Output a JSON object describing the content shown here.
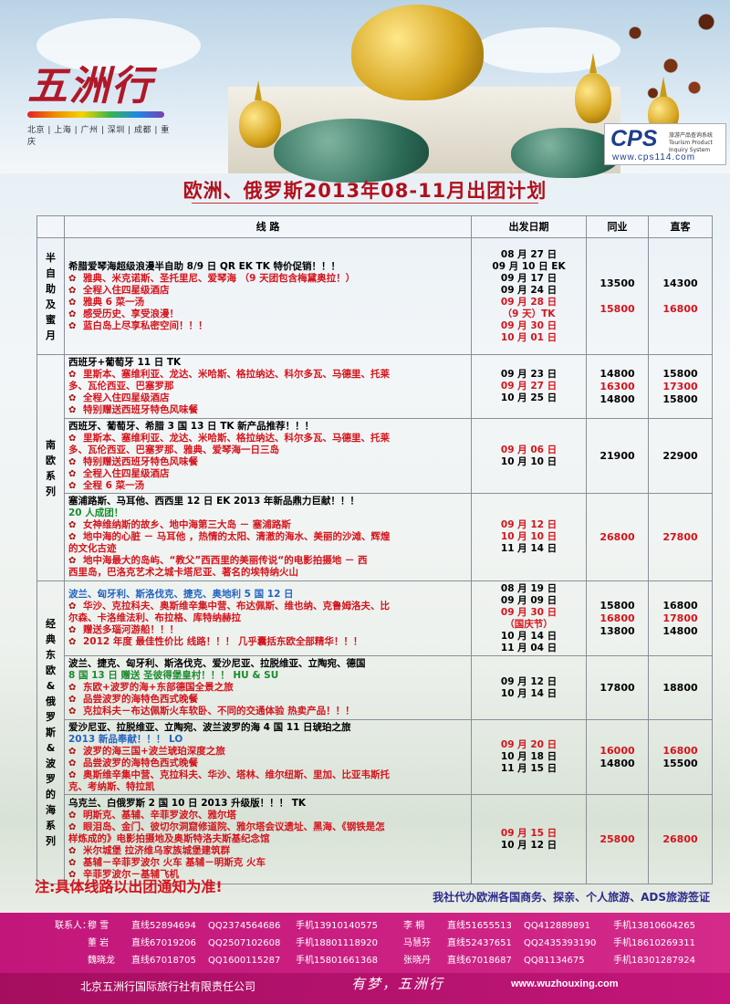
{
  "header": {
    "logo_text": "五洲行",
    "logo_cities": "北京 | 上海 | 广州 | 深圳 | 成都 | 重庆",
    "cps_brand": "CPS",
    "cps_subtitle": "旅游产品查询系统 Tourism Product Inquiry System",
    "cps_url": "www.cps114.com"
  },
  "title": "欧洲、俄罗斯2013年08-11月出团计划",
  "table": {
    "headers": {
      "route": "线 路",
      "dates": "出发日期",
      "peer": "同业",
      "direct": "直客"
    },
    "categories": {
      "c1": "半自助及蜜月",
      "c2": "南欧系列",
      "c3": "经典东欧&俄罗斯&波罗的海系列"
    },
    "rows": [
      {
        "lines": [
          "希腊爱琴海超级浪漫半自助 8/9 日 QR EK TK 特价促销！！！",
          "雅典、米克诺斯、圣托里尼、爱琴海 （9 天团包含梅黛奥拉！）",
          "全程入住四星级酒店",
          "雅典 6 菜一汤",
          "感受历史、享受浪漫！",
          "蓝白岛上尽享私密空间！！！"
        ],
        "dates": [
          "08 月 27 日",
          "09 月 10 日 EK",
          "09 月 17 日",
          "09 月 24 日",
          "09 月 28 日",
          "（9 天）TK",
          "09 月 30 日",
          "10 月 01 日"
        ],
        "peer": [
          "13500",
          "15800"
        ],
        "direct": [
          "14300",
          "16800"
        ]
      },
      {
        "lines": [
          "西班牙+葡萄牙 11 日 TK",
          "里斯本、塞维利亚、龙达、米哈斯、格拉纳达、科尔多瓦、马德里、托莱",
          "多、瓦伦西亚、巴塞罗那",
          "全程入住四星级酒店",
          "特别赠送西班牙特色风味餐"
        ],
        "dates": [
          "09 月 23 日",
          "09 月 27 日",
          "10 月 25 日"
        ],
        "peer": [
          "14800",
          "16300",
          "14800"
        ],
        "direct": [
          "15800",
          "17300",
          "15800"
        ]
      },
      {
        "lines": [
          "西班牙、葡萄牙、希腊 3 国 13 日 TK 新产品推荐！！！",
          "里斯本、塞维利亚、龙达、米哈斯、格拉纳达、科尔多瓦、马德里、托莱",
          "多、瓦伦西亚、巴塞罗那、雅典、爱琴海一日三岛",
          "特别赠送西班牙特色风味餐",
          "全程入住四星级酒店",
          "全程 6 菜一汤"
        ],
        "dates": [
          "09 月 06 日",
          "10 月 10 日"
        ],
        "peer": [
          "21900"
        ],
        "direct": [
          "22900"
        ]
      },
      {
        "lines": [
          "塞浦路斯、马耳他、西西里 12 日 EK 2013 年新品鼎力巨献！！！",
          "20 人成团！",
          "女神维纳斯的故乡、地中海第三大岛 － 塞浦路斯",
          "地中海的心脏 － 马耳他 ，热情的太阳、清澈的海水、美丽的沙滩、辉煌",
          "的文化古迹",
          "地中海最大的岛屿、“教父”西西里的美丽传说“的电影拍摄地 － 西",
          "西里岛，巴洛克艺术之城卡塔尼亚、著名的埃特纳火山"
        ],
        "dates": [
          "09 月 12 日",
          "10 月 10 日",
          "11 月 14 日"
        ],
        "peer": [
          "26800"
        ],
        "direct": [
          "27800"
        ]
      },
      {
        "lines": [
          "波兰、匈牙利、斯洛伐克、捷克、奥地利 5 国 12 日",
          "华沙、克拉科夫、奥斯维辛集中营、布达佩斯、维也纳、克鲁姆洛夫、比",
          "尔森、卡洛维法利、布拉格、库特纳赫拉",
          "赠送多瑙河游船！！！",
          "2012 年度 最佳性价比 线路！！！ 几乎囊括东欧全部精华！！！"
        ],
        "dates": [
          "08 月 19 日",
          "09 月 09 日",
          "09 月 30 日",
          "（国庆节）",
          "10 月 14 日",
          "11 月 04 日"
        ],
        "peer": [
          "15800",
          "16800",
          "13800"
        ],
        "direct": [
          "16800",
          "17800",
          "14800"
        ]
      },
      {
        "lines": [
          "波兰、捷克、匈牙利、斯洛伐克、爱沙尼亚、拉脱维亚、立陶宛、德国",
          "8 国 13 日 赠送 圣彼得堡皇村！！！ HU & SU",
          "东欧+波罗的海+东部德国全景之旅",
          "品尝波罗的海特色西式晚餐",
          "克拉科夫－布达佩斯火车软卧、不同的交通体验 热卖产品！！！"
        ],
        "dates": [
          "09 月 12 日",
          "10 月 14 日"
        ],
        "peer": [
          "17800"
        ],
        "direct": [
          "18800"
        ]
      },
      {
        "lines": [
          "爱沙尼亚、拉脱维亚、立陶宛、波兰波罗的海 4 国 11 日琥珀之旅",
          "2013 新品奉献！！！ LO",
          "波罗的海三国+波兰琥珀深度之旅",
          "品尝波罗的海特色西式晚餐",
          "奥斯维辛集中营、克拉科夫、华沙、塔林、维尔纽斯、里加、比亚韦斯托",
          "克、考纳斯、特拉凯"
        ],
        "dates": [
          "09 月 20 日",
          "10 月 18 日",
          "11 月 15 日"
        ],
        "peer": [
          "16000",
          "14800"
        ],
        "direct": [
          "16800",
          "15500"
        ]
      },
      {
        "lines": [
          "乌克兰、白俄罗斯 2 国 10 日 2013 升级版！！！ TK",
          "明斯克、基辅、辛菲罗波尔、雅尔塔",
          "眼泪岛、金门、彼切尔洞窟修道院、雅尔塔会议遗址、黑海、《钢铁是怎",
          "样炼成的》电影拍摄地及奥斯特洛夫斯基纪念馆",
          "米尔城堡 拉济维乌家族城堡建筑群",
          "基辅－辛菲罗波尔 火车 基辅－明斯克 火车",
          "辛菲罗波尔－基辅飞机"
        ],
        "dates": [
          "09 月 15 日",
          "10 月 12 日"
        ],
        "peer": [
          "25800"
        ],
        "direct": [
          "26800"
        ]
      }
    ]
  },
  "note": "注:具体线路以出团通知为准!",
  "service": "我社代办欧洲各国商务、探亲、个人旅游、ADS旅游签证",
  "contacts": {
    "label": "联系人：",
    "rows": [
      [
        {
          "name": "穆 雪",
          "tel": "直线52894694",
          "qq": "QQ2374564686",
          "mobile": "手机13910140575"
        },
        {
          "name": "李 桐",
          "tel": "直线51655513",
          "qq": "QQ412889891",
          "mobile": "手机13810604265"
        }
      ],
      [
        {
          "name": "董 岩",
          "tel": "直线67019206",
          "qq": "QQ2507102608",
          "mobile": "手机18801118920"
        },
        {
          "name": "马慧芬",
          "tel": "直线52437651",
          "qq": "QQ2435393190",
          "mobile": "手机18610269311"
        }
      ],
      [
        {
          "name": "魏晓龙",
          "tel": "直线67018705",
          "qq": "QQ1600115287",
          "mobile": "手机15801661368"
        },
        {
          "name": "张晓丹",
          "tel": "直线67018687",
          "qq": "QQ81134675",
          "mobile": "手机18301287924"
        }
      ]
    ]
  },
  "footer": {
    "company": "北京五洲行国际旅行社有限责任公司",
    "slogan": "有梦，五洲行",
    "url": "www.wuzhouxing.com"
  }
}
